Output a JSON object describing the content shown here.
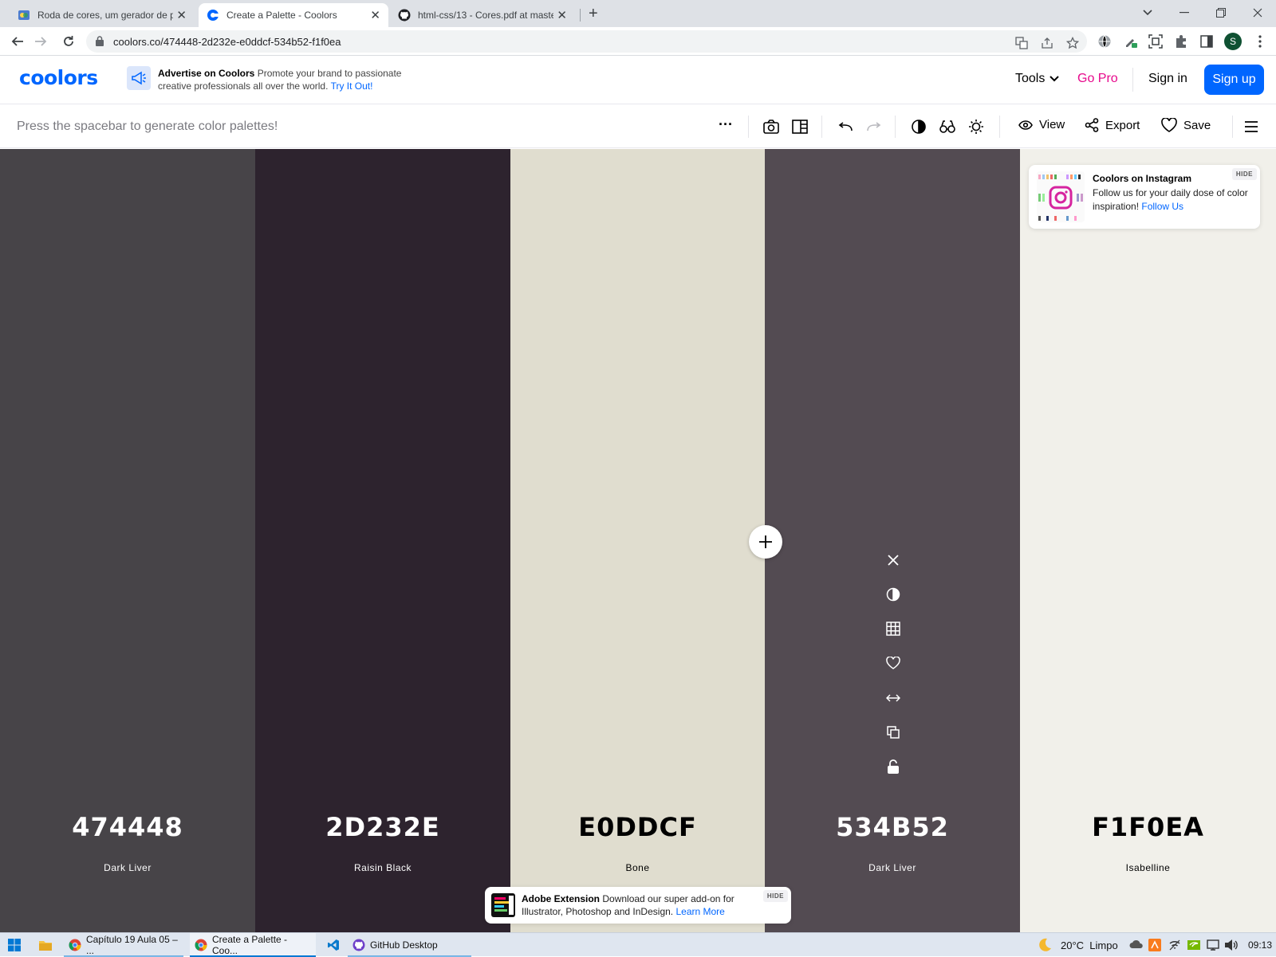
{
  "browser": {
    "tabs": [
      {
        "title": "Roda de cores, um gerador de pa",
        "close": "✕"
      },
      {
        "title": "Create a Palette - Coolors",
        "close": "✕"
      },
      {
        "title": "html-css/13 - Cores.pdf at maste",
        "close": "✕"
      }
    ],
    "new_tab": "+",
    "url": "coolors.co/474448-2d232e-e0ddcf-534b52-f1f0ea",
    "profile_initial": "S"
  },
  "header": {
    "logo": "coolors",
    "ad_title": "Advertise on Coolors",
    "ad_text": "Promote your brand to passionate creative professionals all over the world.",
    "ad_link": "Try It Out!",
    "tools": "Tools",
    "go_pro": "Go Pro",
    "sign_in": "Sign in",
    "sign_up": "Sign up"
  },
  "toolbar": {
    "hint": "Press the spacebar to generate color palettes!",
    "more": "···",
    "view": "View",
    "export": "Export",
    "save": "Save"
  },
  "palette": {
    "colors": [
      {
        "hex": "474448",
        "name": "Dark Liver",
        "bg": "#474448",
        "fg": "#ffffff"
      },
      {
        "hex": "2D232E",
        "name": "Raisin Black",
        "bg": "#2d232e",
        "fg": "#ffffff"
      },
      {
        "hex": "E0DDCF",
        "name": "Bone",
        "bg": "#e0ddcf",
        "fg": "#000000"
      },
      {
        "hex": "534B52",
        "name": "Dark Liver",
        "bg": "#534b52",
        "fg": "#ffffff"
      },
      {
        "hex": "F1F0EA",
        "name": "Isabelline",
        "bg": "#f1f0ea",
        "fg": "#000000"
      }
    ],
    "add": "+"
  },
  "instagram_card": {
    "title": "Coolors on Instagram",
    "text": "Follow us for your daily dose of color inspiration!",
    "link": "Follow Us",
    "hide": "HIDE"
  },
  "adobe_card": {
    "title": "Adobe Extension",
    "text": "Download our super add-on for Illustrator, Photoshop and InDesign.",
    "link": "Learn More",
    "hide": "HIDE"
  },
  "taskbar": {
    "apps": [
      {
        "label": "Capítulo 19 Aula 05 – ..."
      },
      {
        "label": "Create a Palette - Coo..."
      },
      {
        "label": ""
      },
      {
        "label": "GitHub Desktop"
      }
    ],
    "weather": "20°C  Limpo",
    "time": "09:13"
  },
  "colors": {
    "accent": "#0066ff",
    "pro": "#e7098c"
  }
}
